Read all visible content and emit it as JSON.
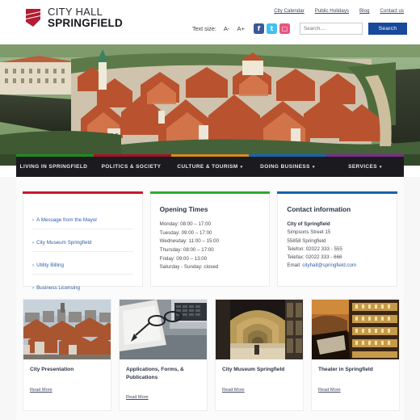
{
  "header": {
    "logo": {
      "line1": "CITY HALL",
      "line2": "SPRINGFIELD",
      "icon": "shield-ribbon-logo",
      "color": "#b31b34"
    },
    "top_links": [
      {
        "label": "City Calendar"
      },
      {
        "label": "Public Holidays"
      },
      {
        "label": "Blog"
      },
      {
        "label": "Contact us"
      }
    ],
    "text_size": {
      "label": "Text size:",
      "decrease": "A-",
      "increase": "A+"
    },
    "social": [
      {
        "name": "facebook-icon",
        "glyph": "f",
        "color": "#3b5998"
      },
      {
        "name": "twitter-icon",
        "glyph": "t",
        "color": "#3ec1f3"
      },
      {
        "name": "instagram-icon",
        "glyph": "▢",
        "color": "#e75480"
      }
    ],
    "search": {
      "placeholder": "Search....",
      "value": "",
      "button": "Search",
      "button_color": "#18499a"
    }
  },
  "hero": {
    "alt": "Aerial view of historic town with red tiled roofs and river"
  },
  "nav": {
    "items": [
      {
        "label": "LIVING IN SPRINGFIELD",
        "caret": "",
        "accent": "#1f8b1f"
      },
      {
        "label": "POLITICS & SOCIETY",
        "caret": "",
        "accent": "#a51226"
      },
      {
        "label": "CULTURE & TOURISM",
        "caret": "▾",
        "accent": "#d78c1c"
      },
      {
        "label": "DOING BUSINESS",
        "caret": "▾",
        "accent": "#1565b0"
      },
      {
        "label": "SERVICES",
        "caret": "▾",
        "accent": "#7d2a8c"
      }
    ]
  },
  "info_cards": {
    "quick_links": {
      "accent": "#c8192e",
      "items": [
        {
          "label": "A Message from the Mayor"
        },
        {
          "label": "City Museum Springfield"
        },
        {
          "label": "Utility Billing"
        },
        {
          "label": "Business Licensing"
        }
      ]
    },
    "opening_times": {
      "accent": "#2eaa2e",
      "title": "Opening Times",
      "rows": [
        "Monday: 08:00 – 17:00",
        "Tuesday: 09:00 – 17:00",
        "Wednesday: 11:00 – 15:00",
        "Thursday: 08:00 – 17:00",
        "Friday: 09:00 – 13:00",
        "Saturday - Sunday: closed"
      ]
    },
    "contact": {
      "accent": "#1465ad",
      "title": "Contact information",
      "org": "City of Springfield",
      "street": "Simpsons Street 15",
      "city": "55858 Springfield",
      "phone": "Telefon: 02022 333 - 555",
      "fax": "Telefax: 02022 333 - 666",
      "email_label": "Email:",
      "email": "cityhall@springfield.com"
    }
  },
  "teasers": [
    {
      "title": "City Presentation",
      "link": "Read More",
      "image": "city-rooftops-photo"
    },
    {
      "title": "Applications, Forms, & Publications",
      "link": "Read More",
      "image": "desk-glasses-laptop-photo"
    },
    {
      "title": "City Museum Springfield",
      "link": "Read More",
      "image": "museum-vaulted-hall-photo"
    },
    {
      "title": "Theater in Springfield",
      "link": "Read More",
      "image": "theater-auditorium-photo"
    }
  ]
}
